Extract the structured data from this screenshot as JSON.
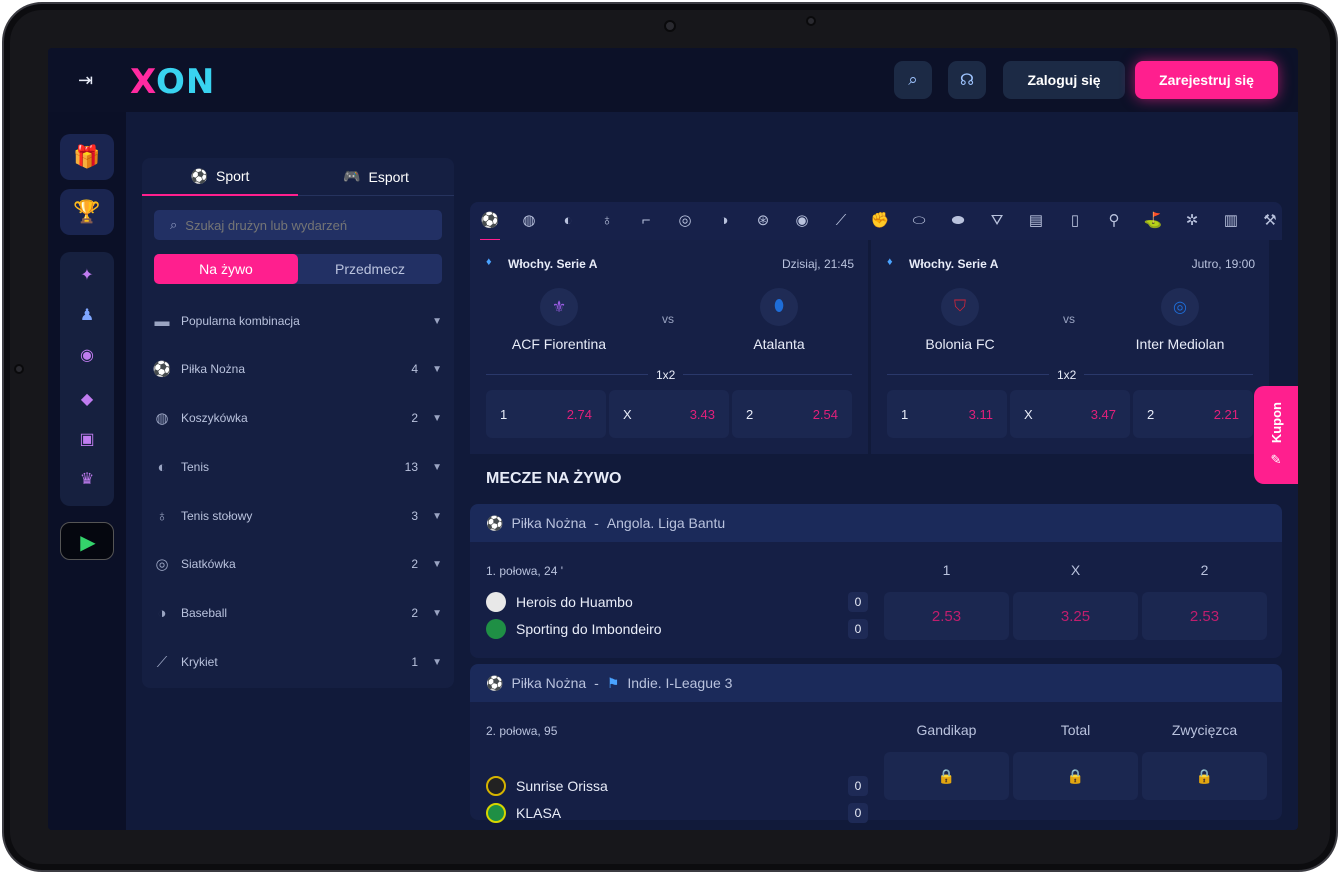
{
  "header": {
    "logo": "XON",
    "login_label": "Zaloguj się",
    "register_label": "Zarejestruj się"
  },
  "sidebar": {
    "tabs": [
      {
        "label": "Sport",
        "icon": "soccer-ball-icon"
      },
      {
        "label": "Esport",
        "icon": "gamepad-icon"
      }
    ],
    "search_placeholder": "Szukaj drużyn lub wydarzeń",
    "mode_live": "Na żywo",
    "mode_pre": "Przedmecz",
    "items": [
      {
        "label": "Popularna kombinacja",
        "count": ""
      },
      {
        "label": "Piłka Nożna",
        "count": "4"
      },
      {
        "label": "Koszykówka",
        "count": "2"
      },
      {
        "label": "Tenis",
        "count": "13"
      },
      {
        "label": "Tenis stołowy",
        "count": "3"
      },
      {
        "label": "Siatkówka",
        "count": "2"
      },
      {
        "label": "Baseball",
        "count": "2"
      },
      {
        "label": "Krykiet",
        "count": "1"
      }
    ]
  },
  "featured": [
    {
      "league": "Włochy. Serie A",
      "time": "Dzisiaj, 21:45",
      "home": "ACF Fiorentina",
      "away": "Atalanta",
      "vs": "vs",
      "market": "1x2",
      "odds": [
        {
          "k": "1",
          "v": "2.74"
        },
        {
          "k": "X",
          "v": "3.43"
        },
        {
          "k": "2",
          "v": "2.54"
        }
      ]
    },
    {
      "league": "Włochy. Serie A",
      "time": "Jutro, 19:00",
      "home": "Bolonia FC",
      "away": "Inter Mediolan",
      "vs": "vs",
      "market": "1x2",
      "odds": [
        {
          "k": "1",
          "v": "3.11"
        },
        {
          "k": "X",
          "v": "3.47"
        },
        {
          "k": "2",
          "v": "2.21"
        }
      ]
    }
  ],
  "live_title": "MECZE NA ŻYWO",
  "kupon_label": "Kupon",
  "matches": [
    {
      "sport": "Piłka Nożna",
      "sep": "-",
      "league": "Angola. Liga Bantu",
      "status": "1. połowa, 24 '",
      "cols": [
        "1",
        "X",
        "2"
      ],
      "home": "Herois do Huambo",
      "away": "Sporting do Imbondeiro",
      "home_score": "0",
      "away_score": "0",
      "odds": [
        "2.53",
        "3.25",
        "2.53"
      ]
    },
    {
      "sport": "Piłka Nożna",
      "sep": "-",
      "league": "Indie. I-League 3",
      "status": "2. połowa, 95",
      "cols": [
        "Gandikap",
        "Total",
        "Zwycięzca"
      ],
      "home": "Sunrise Orissa",
      "away": "KLASA",
      "home_score": "0",
      "away_score": "0"
    }
  ],
  "colors": {
    "accent": "#ff1f8e",
    "cyan": "#39d3f0",
    "bg": "#111a3a"
  }
}
